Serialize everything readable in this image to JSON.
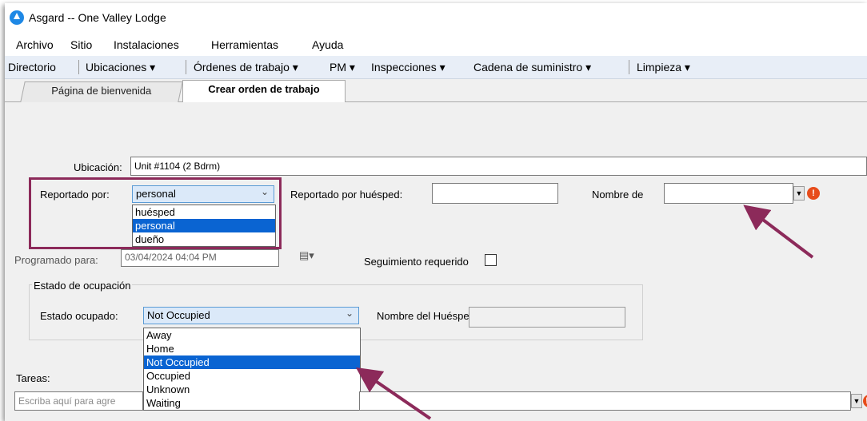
{
  "window": {
    "title": "Asgard -- One Valley Lodge"
  },
  "menu": [
    "Archivo",
    "Sitio",
    "Instalaciones",
    "Herramientas",
    "Ayuda"
  ],
  "toolbar": {
    "directorio": "Directorio",
    "ubicaciones": "Ubicaciones ▾",
    "ordenes": "Órdenes de trabajo ▾",
    "pm": "PM ▾",
    "inspecciones": "Inspecciones ▾",
    "cadena": "Cadena de suministro ▾",
    "limpieza": "Limpieza ▾"
  },
  "tabs": {
    "welcome": "Página de bienvenida",
    "create": "Crear orden de trabajo"
  },
  "form": {
    "ubicacion_label": "Ubicación:",
    "ubicacion_value": "Unit #1104 (2 Bdrm)",
    "reportado_label": "Reportado por:",
    "reportado_value": "personal",
    "reportado_options": [
      "huésped",
      "personal",
      "dueño"
    ],
    "huesped_label": "Reportado por huésped:",
    "nombre_de_label": "Nombre de",
    "programado_label": "Programado para:",
    "programado_value": "03/04/2024 04:04 PM",
    "seguimiento_label": "Seguimiento requerido",
    "estado_group": "Estado de ocupación",
    "estado_label": "Estado ocupado:",
    "estado_value": "Not Occupied",
    "estado_options": [
      "Away",
      "Home",
      "Not Occupied",
      "Occupied",
      "Unknown",
      "Waiting"
    ],
    "nombre_huesped_label": "Nombre del Huésped;",
    "tareas_label": "Tareas:",
    "tareas_placeholder": "Escriba aquí para agre"
  },
  "colors": {
    "accent": "#0a64d2",
    "highlight_box": "#8c2a5a",
    "arrow": "#8c2a5a",
    "warning": "#e74c1b"
  }
}
